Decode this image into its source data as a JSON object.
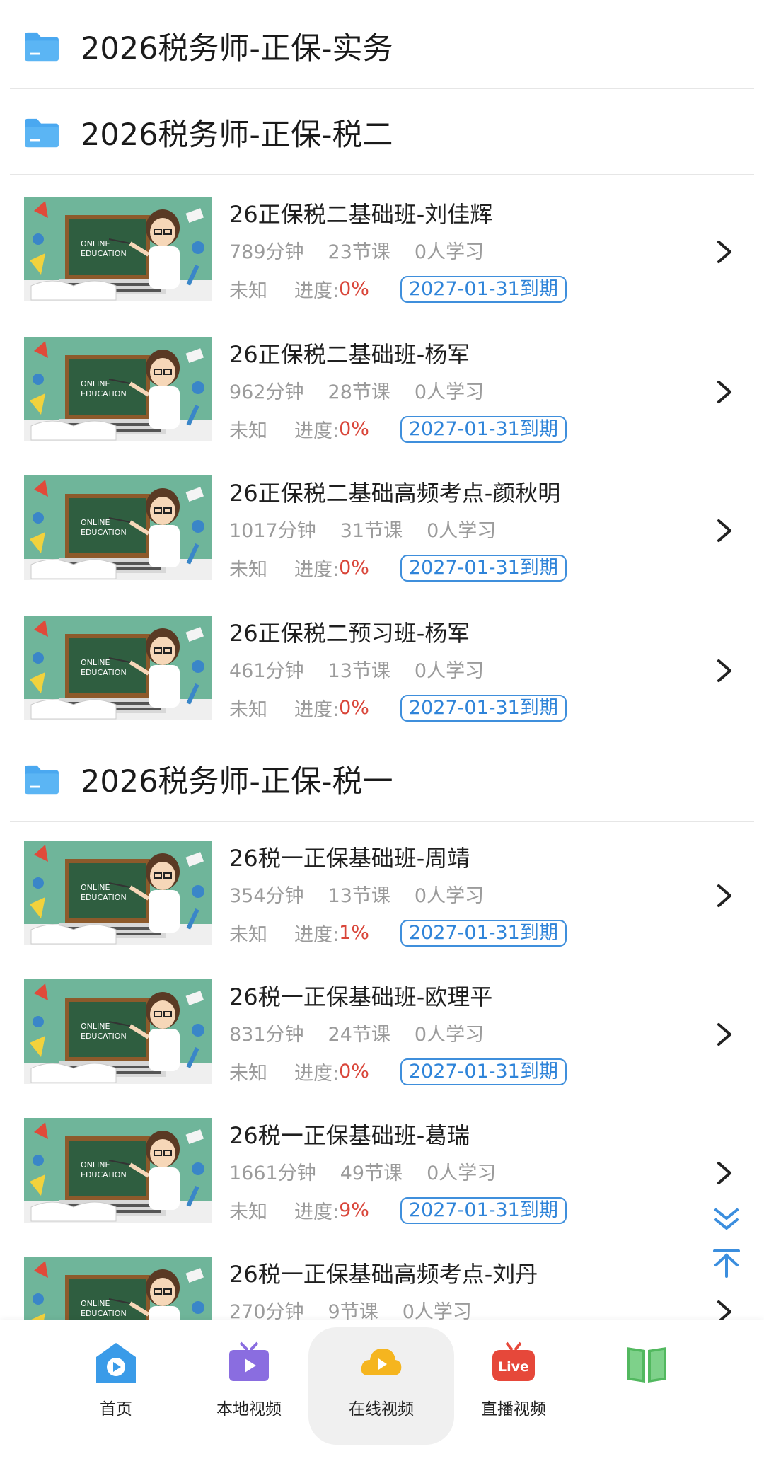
{
  "folders": [
    {
      "title": "2026税务师-正保-实务"
    },
    {
      "title": "2026税务师-正保-税二"
    },
    {
      "title": "2026税务师-正保-税一"
    }
  ],
  "courses": [
    {
      "title": "26正保税二基础班-刘佳辉",
      "minutes": "789分钟",
      "lessons": "23节课",
      "learners": "0人学习",
      "status": "未知",
      "progress_label": "进度:",
      "progress": "0%",
      "expiry": "2027-01-31到期"
    },
    {
      "title": "26正保税二基础班-杨军",
      "minutes": "962分钟",
      "lessons": "28节课",
      "learners": "0人学习",
      "status": "未知",
      "progress_label": "进度:",
      "progress": "0%",
      "expiry": "2027-01-31到期"
    },
    {
      "title": "26正保税二基础高频考点-颜秋明",
      "minutes": "1017分钟",
      "lessons": "31节课",
      "learners": "0人学习",
      "status": "未知",
      "progress_label": "进度:",
      "progress": "0%",
      "expiry": "2027-01-31到期"
    },
    {
      "title": "26正保税二预习班-杨军",
      "minutes": "461分钟",
      "lessons": "13节课",
      "learners": "0人学习",
      "status": "未知",
      "progress_label": "进度:",
      "progress": "0%",
      "expiry": "2027-01-31到期"
    },
    {
      "title": "26税一正保基础班-周靖",
      "minutes": "354分钟",
      "lessons": "13节课",
      "learners": "0人学习",
      "status": "未知",
      "progress_label": "进度:",
      "progress": "1%",
      "expiry": "2027-01-31到期"
    },
    {
      "title": "26税一正保基础班-欧理平",
      "minutes": "831分钟",
      "lessons": "24节课",
      "learners": "0人学习",
      "status": "未知",
      "progress_label": "进度:",
      "progress": "0%",
      "expiry": "2027-01-31到期"
    },
    {
      "title": "26税一正保基础班-葛瑞",
      "minutes": "1661分钟",
      "lessons": "49节课",
      "learners": "0人学习",
      "status": "未知",
      "progress_label": "进度:",
      "progress": "9%",
      "expiry": "2027-01-31到期"
    },
    {
      "title": "26税一正保基础高频考点-刘丹",
      "minutes": "270分钟",
      "lessons": "9节课",
      "learners": "0人学习"
    }
  ],
  "thumbnail_text": {
    "line1": "ONLINE",
    "line2": "EDUCATION"
  },
  "tabs": [
    {
      "label": "首页",
      "icon": "home-icon"
    },
    {
      "label": "本地视频",
      "icon": "local-video-icon"
    },
    {
      "label": "在线视频",
      "icon": "cloud-play-icon",
      "active": true
    },
    {
      "label": "直播视频",
      "icon": "live-tv-icon",
      "badge": "Live"
    },
    {
      "label": "",
      "icon": "book-icon"
    }
  ],
  "colors": {
    "folder_blue": "#4aa8f0",
    "progress_red": "#d9463a",
    "expiry_blue": "#2f84d9",
    "scroll_blue": "#3b8ede"
  }
}
